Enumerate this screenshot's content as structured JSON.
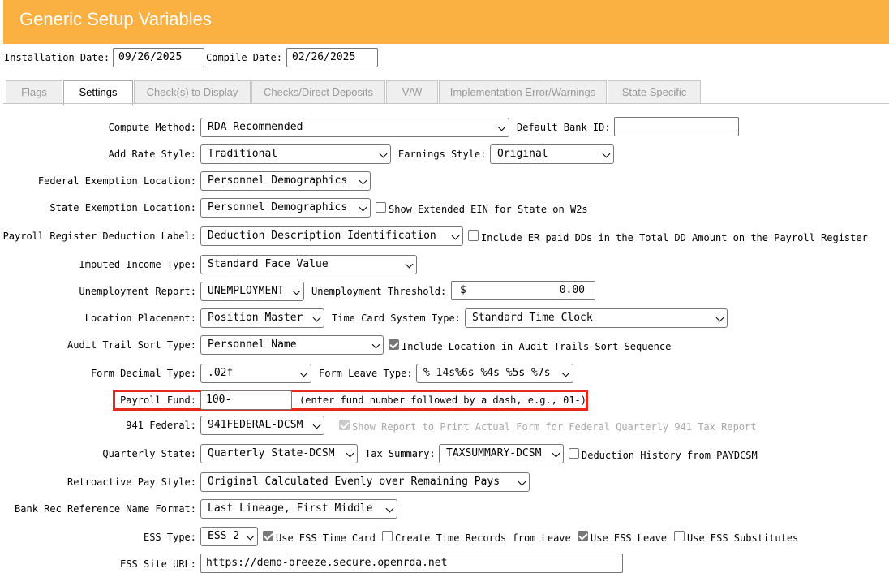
{
  "header": {
    "title": "Generic Setup Variables",
    "color": "#fbb042"
  },
  "dates": {
    "installation_label": "Installation Date:",
    "installation_value": "09/26/2025",
    "compile_label": "Compile Date:",
    "compile_value": "02/26/2025"
  },
  "tabs": [
    {
      "label": "Flags"
    },
    {
      "label": "Settings"
    },
    {
      "label": "Check(s) to Display"
    },
    {
      "label": "Checks/Direct Deposits"
    },
    {
      "label": "V/W"
    },
    {
      "label": "Implementation Error/Warnings"
    },
    {
      "label": "State Specific"
    }
  ],
  "active_tab": "Settings",
  "form": {
    "compute_method": {
      "label": "Compute Method:",
      "value": "RDA Recommended"
    },
    "default_bank": {
      "label": "Default Bank ID:",
      "value": ""
    },
    "add_rate_style": {
      "label": "Add Rate Style:",
      "value": "Traditional"
    },
    "earnings_style": {
      "label": "Earnings Style:",
      "value": "Original"
    },
    "federal_exemption": {
      "label": "Federal Exemption Location:",
      "value": "Personnel Demographics"
    },
    "state_exemption": {
      "label": "State Exemption Location:",
      "value": "Personnel Demographics"
    },
    "show_extended_ein": {
      "label": "Show Extended EIN for State on W2s",
      "checked": false
    },
    "payroll_register_label": {
      "label": "Payroll Register Deduction Label:",
      "value": "Deduction Description Identification"
    },
    "include_er_paid": {
      "label": "Include ER paid DDs in the Total DD Amount on the Payroll Register",
      "checked": false
    },
    "imputed_income": {
      "label": "Imputed Income Type:",
      "value": "Standard Face Value"
    },
    "unemployment_report": {
      "label": "Unemployment Report:",
      "value": "UNEMPLOYMENT"
    },
    "unemployment_threshold": {
      "label": "Unemployment Threshold:",
      "currency": "$",
      "value": "0.00"
    },
    "location_placement": {
      "label": "Location Placement:",
      "value": "Position Master"
    },
    "time_card_system": {
      "label": "Time Card System Type:",
      "value": "Standard Time Clock"
    },
    "audit_trail_sort": {
      "label": "Audit Trail Sort Type:",
      "value": "Personnel Name"
    },
    "include_location_audit": {
      "label": "Include Location in Audit Trails Sort Sequence",
      "checked": true
    },
    "form_decimal": {
      "label": "Form Decimal Type:",
      "value": ".02f"
    },
    "form_leave": {
      "label": "Form Leave Type:",
      "value": "%-14s%6s %4s %5s %7s"
    },
    "payroll_fund": {
      "label": "Payroll Fund:",
      "value": "100-",
      "hint": "(enter fund number followed by a dash, e.g., 01-)"
    },
    "federal_941": {
      "label": "941 Federal:",
      "value": "941FEDERAL-DCSM"
    },
    "show_report_941": {
      "label": "Show Report to Print Actual Form for Federal Quarterly 941 Tax Report",
      "checked": true,
      "disabled": true
    },
    "quarterly_state": {
      "label": "Quarterly State:",
      "value": "Quarterly State-DCSM"
    },
    "tax_summary": {
      "label": "Tax Summary:",
      "value": "TAXSUMMARY-DCSM"
    },
    "deduction_history": {
      "label": "Deduction History from PAYDCSM",
      "checked": false
    },
    "retroactive_pay": {
      "label": "Retroactive Pay Style:",
      "value": "Original Calculated Evenly over Remaining Pays"
    },
    "bank_rec_format": {
      "label": "Bank Rec Reference Name Format:",
      "value": "Last Lineage, First Middle"
    },
    "ess_type": {
      "label": "ESS Type:",
      "value": "ESS 2"
    },
    "use_ess_time_card": {
      "label": "Use ESS Time Card",
      "checked": true
    },
    "create_time_records": {
      "label": "Create Time Records from Leave",
      "checked": false
    },
    "use_ess_leave": {
      "label": "Use ESS Leave",
      "checked": true
    },
    "use_ess_substitutes": {
      "label": "Use ESS Substitutes",
      "checked": false
    },
    "ess_site_url": {
      "label": "ESS Site URL:",
      "value": "https://demo-breeze.secure.openrda.net"
    }
  }
}
